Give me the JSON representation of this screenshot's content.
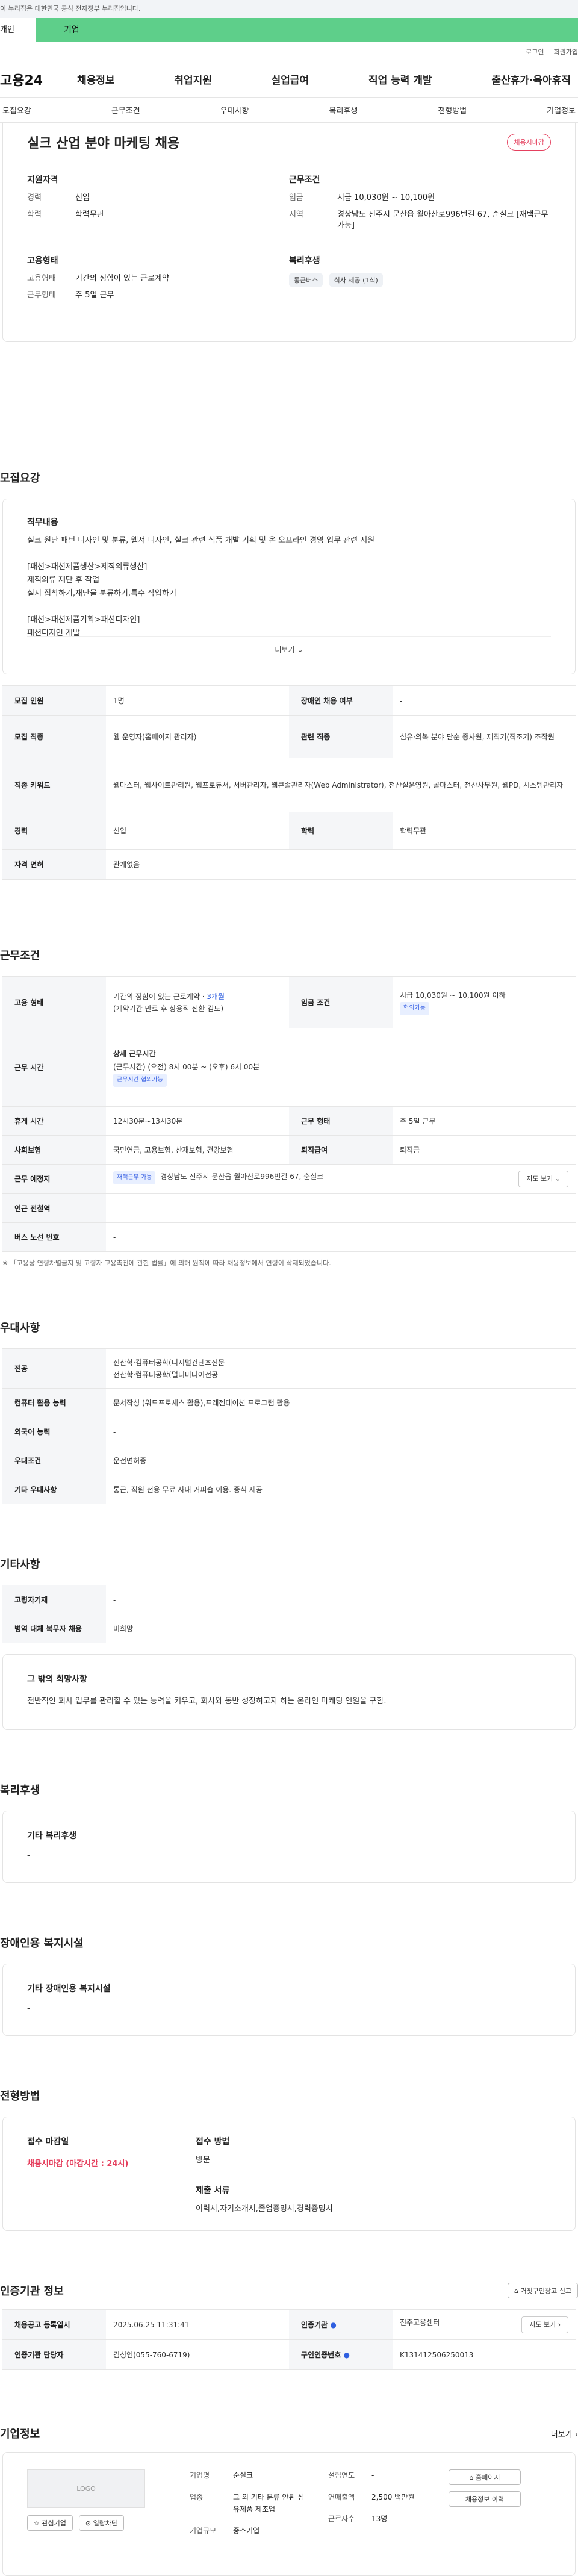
{
  "gov_notice": "이 누리집은 대한민국 공식 전자정부 누리집입니다.",
  "segment": {
    "left": "개인",
    "right": "기업"
  },
  "util": {
    "login": "로그인",
    "join": "회원가입"
  },
  "brand": "고용24",
  "gnb": [
    "채용정보",
    "취업지원",
    "실업급여",
    "직업 능력 개발",
    "출산휴가·육아휴직"
  ],
  "subnav": [
    "모집요강",
    "근무조건",
    "우대사항",
    "복리후생",
    "전형방법",
    "기업정보"
  ],
  "job": {
    "title": "실크 산업 분야 마케팅 채용",
    "status": "채용시마감",
    "qual_heading": "지원자격",
    "cond_heading": "근무조건",
    "type_heading": "고용형태",
    "welfare_heading": "복리후생",
    "career_k": "경력",
    "career_v": "신입",
    "edu_k": "학력",
    "edu_v": "학력무관",
    "wage_k": "임금",
    "wage_v": "시급 10,030원 ~ 10,100원",
    "region_k": "지역",
    "region_v": "경상남도 진주시 문산읍 월아산로996번길 67, 순실크 [재택근무 가능]",
    "emp_k": "고용형태",
    "emp_v": "기간의 정함이 있는 근로계약",
    "work_k": "근무형태",
    "work_v": "주 5일 근무",
    "welfare_chips": [
      "통근버스",
      "식사 제공 (1식)"
    ]
  },
  "sections": {
    "recruit": "모집요강",
    "cond": "근무조건",
    "pref": "우대사항",
    "etc": "기타사항",
    "welfare": "복리후생",
    "disabled": "장애인용 복지시설",
    "apply": "전형방법",
    "cert": "인증기관 정보",
    "company": "기업정보"
  },
  "desc": {
    "heading": "직무내용",
    "text": "실크 원단 패턴 디자인 및 분류, 웹서 디자인, 실크 관련 식품 개발 기획 및 온 오프라인 경영 업무 관련 지원\n\n[패션>패션제품생산>제직의류생산]\n제직의류 재단 후 작업\n실지 접착하기,재단물 분류하기,특수 작업하기\n\n[패션>패션제품기획>패션디자인]\n패션디자인 개발\n디자인 검토하기,디자인 수정 보완하기,디자인 완성하기,아이디어 스케치하기",
    "more": "더보기"
  },
  "recruit_table": {
    "count_k": "모집 인원",
    "count_v": "1명",
    "dis_k": "장애인 채용 여부",
    "dis_v": "-",
    "job_k": "모집 직종",
    "job_v": "웹 운영자(홈페이지 관리자)",
    "rel_k": "관련 직종",
    "rel_v": "섬유·의복 분야 단순 종사원, 제직기(직조기) 조작원",
    "kw_k": "직종 키워드",
    "kw_v": "웹마스터, 웹사이트관리원, 웹프로듀서, 서버관리자, 웹콘솔관리자(Web Administrator), 전산실운영원, 콜마스터, 전산사무원, 웹PD, 시스템관리자",
    "career_k": "경력",
    "career_v": "신입",
    "edu_k": "학력",
    "edu_v": "학력무관",
    "lic_k": "자격 면허",
    "lic_v": "관계없음"
  },
  "cond_table": {
    "emp_k": "고용 형태",
    "emp_v": "기간의 정함이 있는 근로계약 · ",
    "emp_months": "3개월",
    "emp_sub": "(계약기간 만료 후 상용직 전환 검토)",
    "wage_k": "임금 조건",
    "wage_v": "시급 10,030원 ~ 10,100원 이하",
    "wage_tag": "협의가능",
    "time_k": "근무 시간",
    "time_h": "상세 근무시간",
    "time_v": "(근무시간) (오전) 8시 00분 ~ (오후) 6시 00분",
    "time_tag": "근무시간 협의가능",
    "rest_k": "휴게 시간",
    "rest_v": "12시30분~13시30분",
    "form_k": "근무 형태",
    "form_v": "주 5일 근무",
    "ins_k": "사회보험",
    "ins_v": "국민연금, 고용보험, 산재보험, 건강보험",
    "ret_k": "퇴직급여",
    "ret_v": "퇴직금",
    "place_k": "근무 예정지",
    "place_tag": "재택근무 가능",
    "place_v": "경상남도 진주시 문산읍 월아산로996번길 67, 순실크",
    "map": "지도 보기",
    "sub_k": "인근 전철역",
    "sub_v": "-",
    "bus_k": "버스 노선 번호",
    "bus_v": "-"
  },
  "cond_note": "※ 「고용상 연령차별금지 및 고령자 고용촉진에 관한 법률」에 의해 원칙에 따라 채용정보에서 연령이 삭제되었습니다.",
  "pref_table": {
    "major_k": "전공",
    "major_v1": "전산학·컴퓨터공학(디지털컨텐츠전문",
    "major_v2": "전산학·컴퓨터공학(멀티미디어전공",
    "comp_k": "컴퓨터 활용 능력",
    "comp_v": "문서작성 (워드프로세스 활용),프레젠테이션 프로그램 활용",
    "lang_k": "외국어 능력",
    "lang_v": "-",
    "pref_k": "우대조건",
    "pref_v": "운전면허증",
    "etc_k": "기타 우대사항",
    "etc_v": "통근, 직원 전용 무료 사내 커피숍 이용. 중식 제공"
  },
  "etc_table": {
    "elderly_k": "고령자기재",
    "elderly_v": "-",
    "mil_k": "병역 대체 복무자 채용",
    "mil_v": "비희망"
  },
  "want": {
    "heading": "그 밖의 희망사항",
    "text": "전반적인 회사 업무를 관리할 수 있는 능력을 키우고, 회사와 동반 성장하고자 하는 온라인 마케팅 인원을 구함."
  },
  "welfare_box": {
    "heading": "기타 복리후생",
    "text": "-"
  },
  "disabled_box": {
    "heading": "기타 장애인용 복지시설",
    "text": "-"
  },
  "apply": {
    "deadline_h": "접수 마감일",
    "deadline_v": "채용시마감 (마감시간 : 24시)",
    "method_h": "접수 방법",
    "method_v": "방문",
    "docs_h": "제출 서류",
    "docs_v": "이력서,자기소개서,졸업증명서,경력증명서"
  },
  "cert": {
    "report_btn": "거짓구인광고 신고",
    "reg_k": "채용공고 등록일시",
    "reg_v": "2025.06.25 11:31:41",
    "org_k": "인증기관",
    "org_v": "진주고용센터",
    "org_btn": "지도 보기",
    "staff_k": "인증기관 담당자",
    "staff_v": "김성연(055-760-6719)",
    "no_k": "구인인증번호",
    "no_v": "K131412506250013"
  },
  "company": {
    "more": "더보기",
    "logo": "LOGO",
    "fav_btn": "관심기업",
    "block_btn": "열람차단",
    "name_k": "기업명",
    "name_v": "순실크",
    "biz_k": "업종",
    "biz_v": "그 외 기타 분류 안된 섬유제품 제조업",
    "size_k": "기업규모",
    "size_v": "중소기업",
    "est_k": "설립연도",
    "est_v": "-",
    "sales_k": "연매출액",
    "sales_v": "2,500 백만원",
    "emp_k": "근로자수",
    "emp_v": "13명",
    "home_btn": "홈페이지",
    "jobs_btn": "채용정보 이력"
  }
}
